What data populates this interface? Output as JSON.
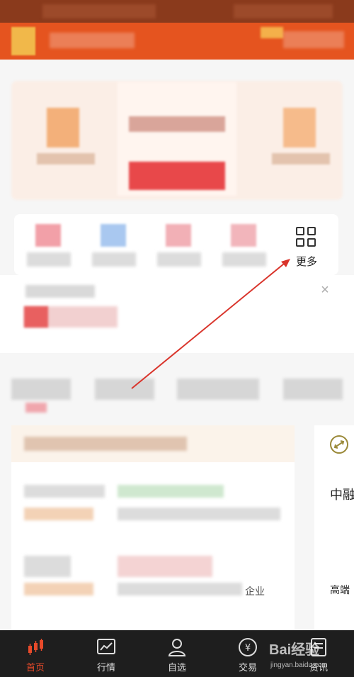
{
  "quick_menu": {
    "more_label": "更多"
  },
  "feed": {
    "tail_text": "企业"
  },
  "side_card": {
    "title_fragment": "中融",
    "subtitle_fragment": "高端"
  },
  "tabbar": {
    "items": [
      {
        "label": "首页",
        "icon": "candlestick-icon",
        "active": true
      },
      {
        "label": "行情",
        "icon": "line-chart-icon",
        "active": false
      },
      {
        "label": "自选",
        "icon": "user-icon",
        "active": false
      },
      {
        "label": "交易",
        "icon": "yen-icon",
        "active": false
      },
      {
        "label": "资讯",
        "icon": "news-icon",
        "active": false
      }
    ]
  },
  "watermark": {
    "brand": "Bai经验",
    "url": "jingyan.baidu.com"
  },
  "colors": {
    "header": "#e5541f",
    "accent_red": "#e84a2a",
    "annotation_arrow": "#d9342b",
    "tabbar_bg": "#1e1e1e"
  }
}
